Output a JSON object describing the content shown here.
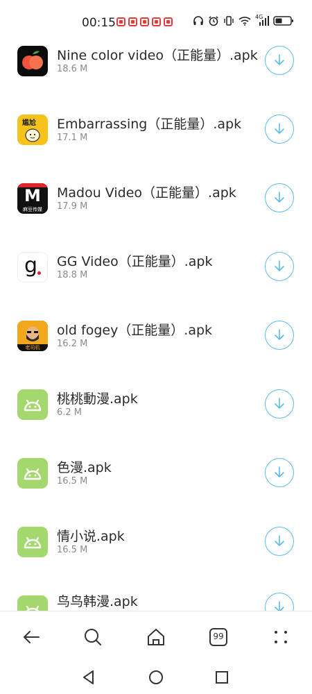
{
  "status_bar": {
    "time": "00:15",
    "network": "4G"
  },
  "files": [
    {
      "name": "Nine color video（正能量）.apk",
      "size": "18.6 M",
      "icon": "peach-app-icon"
    },
    {
      "name": "Embarrassing（正能量）.apk",
      "size": "17.1 M",
      "icon": "yellow-cartoon-app-icon"
    },
    {
      "name": "Madou Video（正能量）.apk",
      "size": "17.9 M",
      "icon": "madou-m-app-icon"
    },
    {
      "name": "GG Video（正能量）.apk",
      "size": "18.8 M",
      "icon": "g-letter-app-icon"
    },
    {
      "name": "old fogey（正能量）.apk",
      "size": "16.2 M",
      "icon": "bearded-man-app-icon"
    },
    {
      "name": "桃桃動漫.apk",
      "size": "6.2 M",
      "icon": "android-icon"
    },
    {
      "name": "色漫.apk",
      "size": "16.5 M",
      "icon": "android-icon"
    },
    {
      "name": "情小说.apk",
      "size": "16.5 M",
      "icon": "android-icon"
    },
    {
      "name": "鸟鸟韩漫.apk",
      "size": "",
      "icon": "android-icon"
    }
  ],
  "icon_text": {
    "madou_badge": "麻豆传媒",
    "embarrassing_text": "尴尬",
    "oldfogey_badge": "老司机",
    "tabs_count": "99"
  },
  "colors": {
    "accent": "#5cbbe8",
    "android_green": "#a4d86e",
    "notification_red": "#e23b3b"
  }
}
